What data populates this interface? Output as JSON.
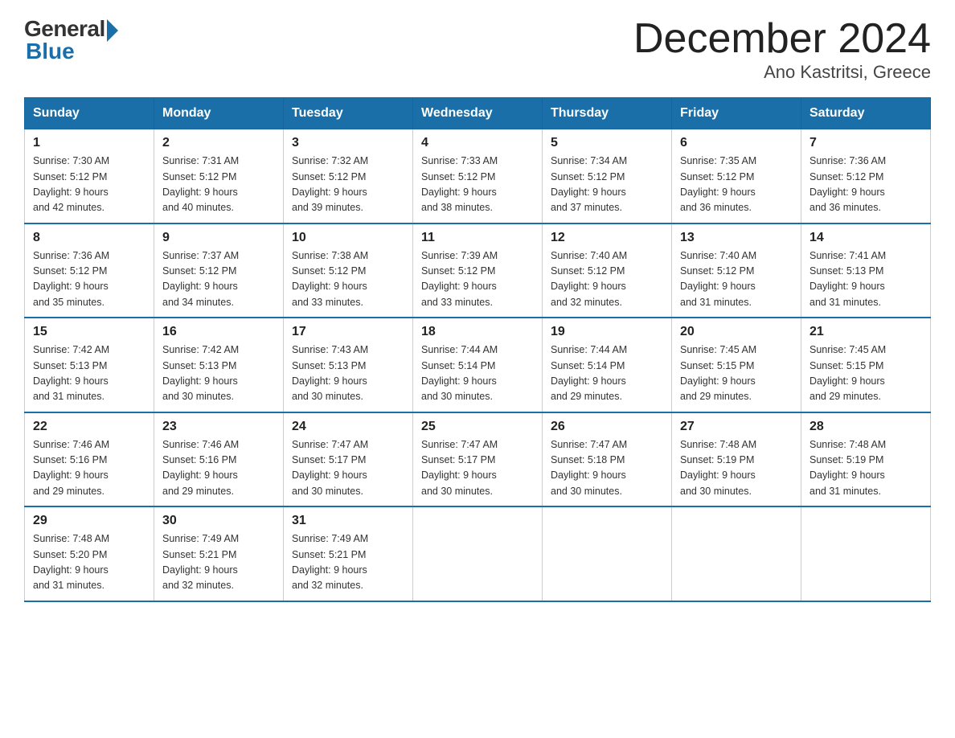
{
  "logo": {
    "general": "General",
    "blue": "Blue"
  },
  "title": "December 2024",
  "subtitle": "Ano Kastritsi, Greece",
  "weekdays": [
    "Sunday",
    "Monday",
    "Tuesday",
    "Wednesday",
    "Thursday",
    "Friday",
    "Saturday"
  ],
  "weeks": [
    [
      {
        "day": "1",
        "sunrise": "7:30 AM",
        "sunset": "5:12 PM",
        "daylight": "9 hours and 42 minutes."
      },
      {
        "day": "2",
        "sunrise": "7:31 AM",
        "sunset": "5:12 PM",
        "daylight": "9 hours and 40 minutes."
      },
      {
        "day": "3",
        "sunrise": "7:32 AM",
        "sunset": "5:12 PM",
        "daylight": "9 hours and 39 minutes."
      },
      {
        "day": "4",
        "sunrise": "7:33 AM",
        "sunset": "5:12 PM",
        "daylight": "9 hours and 38 minutes."
      },
      {
        "day": "5",
        "sunrise": "7:34 AM",
        "sunset": "5:12 PM",
        "daylight": "9 hours and 37 minutes."
      },
      {
        "day": "6",
        "sunrise": "7:35 AM",
        "sunset": "5:12 PM",
        "daylight": "9 hours and 36 minutes."
      },
      {
        "day": "7",
        "sunrise": "7:36 AM",
        "sunset": "5:12 PM",
        "daylight": "9 hours and 36 minutes."
      }
    ],
    [
      {
        "day": "8",
        "sunrise": "7:36 AM",
        "sunset": "5:12 PM",
        "daylight": "9 hours and 35 minutes."
      },
      {
        "day": "9",
        "sunrise": "7:37 AM",
        "sunset": "5:12 PM",
        "daylight": "9 hours and 34 minutes."
      },
      {
        "day": "10",
        "sunrise": "7:38 AM",
        "sunset": "5:12 PM",
        "daylight": "9 hours and 33 minutes."
      },
      {
        "day": "11",
        "sunrise": "7:39 AM",
        "sunset": "5:12 PM",
        "daylight": "9 hours and 33 minutes."
      },
      {
        "day": "12",
        "sunrise": "7:40 AM",
        "sunset": "5:12 PM",
        "daylight": "9 hours and 32 minutes."
      },
      {
        "day": "13",
        "sunrise": "7:40 AM",
        "sunset": "5:12 PM",
        "daylight": "9 hours and 31 minutes."
      },
      {
        "day": "14",
        "sunrise": "7:41 AM",
        "sunset": "5:13 PM",
        "daylight": "9 hours and 31 minutes."
      }
    ],
    [
      {
        "day": "15",
        "sunrise": "7:42 AM",
        "sunset": "5:13 PM",
        "daylight": "9 hours and 31 minutes."
      },
      {
        "day": "16",
        "sunrise": "7:42 AM",
        "sunset": "5:13 PM",
        "daylight": "9 hours and 30 minutes."
      },
      {
        "day": "17",
        "sunrise": "7:43 AM",
        "sunset": "5:13 PM",
        "daylight": "9 hours and 30 minutes."
      },
      {
        "day": "18",
        "sunrise": "7:44 AM",
        "sunset": "5:14 PM",
        "daylight": "9 hours and 30 minutes."
      },
      {
        "day": "19",
        "sunrise": "7:44 AM",
        "sunset": "5:14 PM",
        "daylight": "9 hours and 29 minutes."
      },
      {
        "day": "20",
        "sunrise": "7:45 AM",
        "sunset": "5:15 PM",
        "daylight": "9 hours and 29 minutes."
      },
      {
        "day": "21",
        "sunrise": "7:45 AM",
        "sunset": "5:15 PM",
        "daylight": "9 hours and 29 minutes."
      }
    ],
    [
      {
        "day": "22",
        "sunrise": "7:46 AM",
        "sunset": "5:16 PM",
        "daylight": "9 hours and 29 minutes."
      },
      {
        "day": "23",
        "sunrise": "7:46 AM",
        "sunset": "5:16 PM",
        "daylight": "9 hours and 29 minutes."
      },
      {
        "day": "24",
        "sunrise": "7:47 AM",
        "sunset": "5:17 PM",
        "daylight": "9 hours and 30 minutes."
      },
      {
        "day": "25",
        "sunrise": "7:47 AM",
        "sunset": "5:17 PM",
        "daylight": "9 hours and 30 minutes."
      },
      {
        "day": "26",
        "sunrise": "7:47 AM",
        "sunset": "5:18 PM",
        "daylight": "9 hours and 30 minutes."
      },
      {
        "day": "27",
        "sunrise": "7:48 AM",
        "sunset": "5:19 PM",
        "daylight": "9 hours and 30 minutes."
      },
      {
        "day": "28",
        "sunrise": "7:48 AM",
        "sunset": "5:19 PM",
        "daylight": "9 hours and 31 minutes."
      }
    ],
    [
      {
        "day": "29",
        "sunrise": "7:48 AM",
        "sunset": "5:20 PM",
        "daylight": "9 hours and 31 minutes."
      },
      {
        "day": "30",
        "sunrise": "7:49 AM",
        "sunset": "5:21 PM",
        "daylight": "9 hours and 32 minutes."
      },
      {
        "day": "31",
        "sunrise": "7:49 AM",
        "sunset": "5:21 PM",
        "daylight": "9 hours and 32 minutes."
      },
      null,
      null,
      null,
      null
    ]
  ],
  "labels": {
    "sunrise": "Sunrise:",
    "sunset": "Sunset:",
    "daylight": "Daylight:"
  }
}
